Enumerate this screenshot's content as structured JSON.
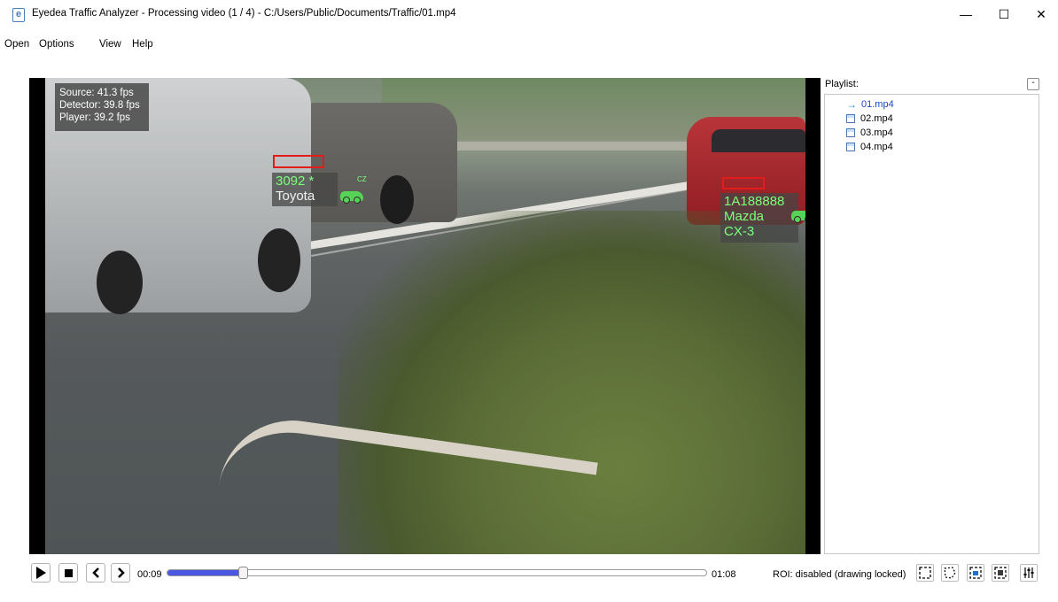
{
  "window": {
    "title": "Eyedea Traffic Analyzer - Processing video (1 / 4) - C:/Users/Public/Documents/Traffic/01.mp4",
    "app_icon_glyph": "e",
    "minimize_glyph": "—",
    "maximize_glyph": "☐",
    "close_glyph": "✕"
  },
  "menu": {
    "items": [
      "Open",
      "Options",
      "View",
      "Help"
    ]
  },
  "video": {
    "stats": {
      "source": "Source: 41.3 fps",
      "detector": "Detector: 39.8 fps",
      "player": "Player: 39.2 fps"
    },
    "detections": [
      {
        "plate": "3092 *",
        "brand": "Toyota",
        "country": "CZ",
        "plate_box_color": "#e21b1b",
        "text_color": "#7cff7a"
      },
      {
        "plate": "1A188888",
        "brand": "Mazda",
        "model": "CX-3",
        "country": "CZ",
        "plate_box_color": "#e21b1b",
        "text_color": "#7cff7a"
      }
    ]
  },
  "playlist": {
    "label": "Playlist:",
    "collapse_glyph": "-",
    "items": [
      {
        "name": "01.mp4",
        "icon": "arrow-right-icon",
        "active": true
      },
      {
        "name": "02.mp4",
        "icon": "video-file-icon",
        "active": false
      },
      {
        "name": "03.mp4",
        "icon": "video-file-icon",
        "active": false
      },
      {
        "name": "04.mp4",
        "icon": "video-file-icon",
        "active": false
      }
    ]
  },
  "player": {
    "current_time": "00:09",
    "total_time": "01:08",
    "progress": 0.14,
    "accent_color": "#4a57e0",
    "roi_status": "ROI: disabled (drawing locked)",
    "tools": [
      "roi-rectangle-icon",
      "roi-polygon-icon",
      "roi-rectangle-locked-icon",
      "roi-select-icon",
      "settings-sliders-icon"
    ]
  }
}
